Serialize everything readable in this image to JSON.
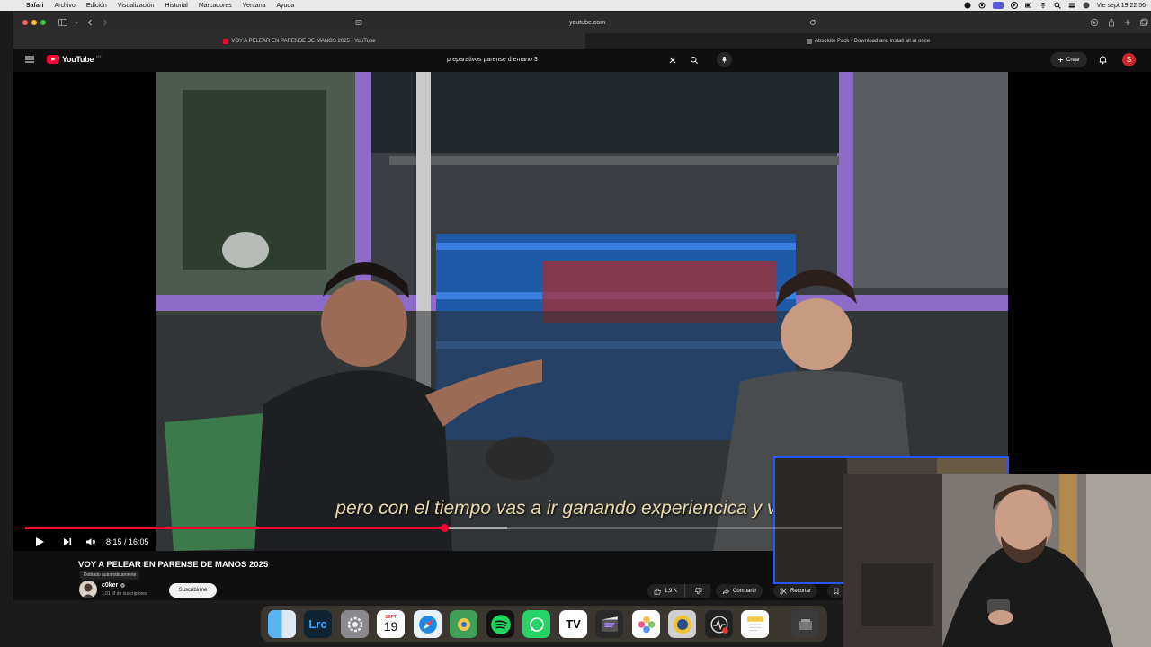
{
  "menubar": {
    "app_name": "Safari",
    "menus": [
      "Archivo",
      "Edición",
      "Visualización",
      "Historial",
      "Marcadores",
      "Ventana",
      "Ayuda"
    ],
    "clock": "Vie sept 19  22:56"
  },
  "browser": {
    "address": "youtube.com",
    "tabs": [
      {
        "label": "VOY A PELEAR EN PARENSE DE MANOS 2025 - YouTube",
        "active": true
      },
      {
        "label": "Absolute Pack - Download and install all at once",
        "active": false
      }
    ]
  },
  "youtube": {
    "logo_text": "YouTube",
    "country_code": "UY",
    "search_value": "preparativos parense d emano 3",
    "create_label": "Crear",
    "avatar_letter": "S",
    "subtitle": "pero con el tiempo vas a ir ganando experiencica y vas a ir",
    "time_display": "8:15 / 16:05",
    "progress": 0.5135,
    "buffered_to": 0.59,
    "video_title": "VOY A PELEAR EN PARENSE DE MANOS 2025",
    "dub_badge": "Doblado automáticamente",
    "channel_name": "c0ker",
    "channel_subs": "1,01 M de suscriptores",
    "subscribe_label": "Suscribirme",
    "likes": "1,9 K",
    "share_label": "Compartir",
    "clip_label": "Recortar"
  },
  "colors": {
    "yt_red": "#ff0033",
    "cam_border": "#2a56ff",
    "subtitle_text": "#e9d9a8"
  },
  "dock": {
    "apps": [
      {
        "name": "finder-icon",
        "label": ""
      },
      {
        "name": "lightroom-icon",
        "label": "Lrc"
      },
      {
        "name": "system-settings-icon",
        "label": ""
      },
      {
        "name": "calendar-icon",
        "label": "19",
        "month": "SEPT"
      },
      {
        "name": "safari-icon",
        "label": ""
      },
      {
        "name": "maps-app-icon",
        "label": ""
      },
      {
        "name": "spotify-icon",
        "label": ""
      },
      {
        "name": "whatsapp-icon",
        "label": ""
      },
      {
        "name": "tradingview-icon",
        "label": "TV"
      },
      {
        "name": "final-cut-icon",
        "label": ""
      },
      {
        "name": "photos-icon",
        "label": ""
      },
      {
        "name": "compressor-icon",
        "label": ""
      },
      {
        "name": "activity-icon",
        "label": ""
      },
      {
        "name": "notes-icon",
        "label": ""
      }
    ]
  }
}
